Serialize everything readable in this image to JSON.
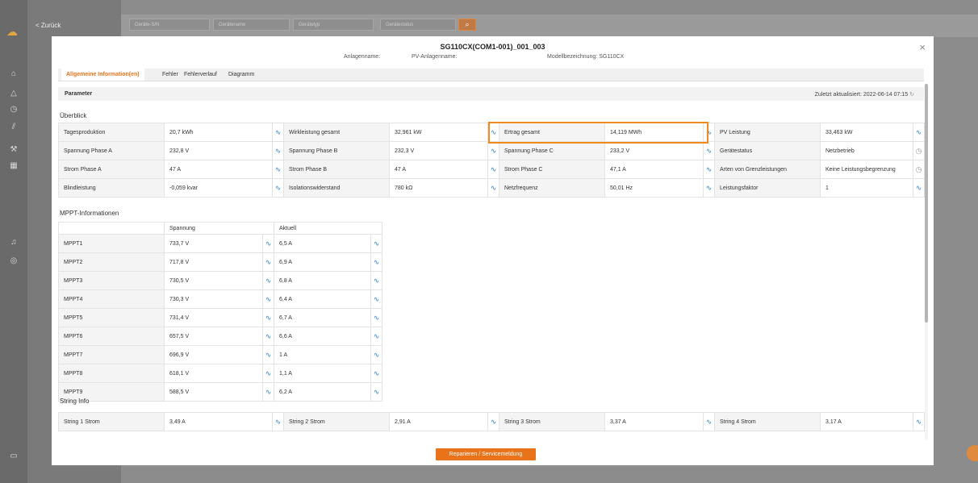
{
  "background": {
    "back_label": "< Zurück",
    "filters": [
      {
        "placeholder": "Geräte-S/N"
      },
      {
        "placeholder": "Gerätename"
      },
      {
        "placeholder": "Gerätetyp"
      },
      {
        "placeholder": "Gerätestatus"
      }
    ]
  },
  "modal": {
    "title": "SG110CX(COM1-001)_001_003",
    "plant_name_label": "Anlagenname:",
    "pv_plant_name_label": "PV-Anlagenname:",
    "model_label": "Modellbezeichnung: SG110CX",
    "tabs": [
      {
        "label": "Allgemeine Information(en)",
        "active": true
      },
      {
        "label": "Fehler"
      },
      {
        "label": "Fehlerverlauf"
      },
      {
        "label": "Diagramm"
      }
    ],
    "param_label": "Parameter",
    "last_updated": "Zuletzt aktualisiert: 2022-06-14 07:15",
    "repair_button": "Reparieren / Servicemeldung"
  },
  "overview": {
    "title": "Überblick",
    "rows": [
      [
        {
          "label": "Tagesproduktion",
          "value": "20,7 kWh",
          "icon": "trend-icon"
        },
        {
          "label": "Wirkleistung gesamt",
          "value": "32,961 kW",
          "icon": "trend-icon"
        },
        {
          "label": "Ertrag gesamt",
          "value": "14,119 MWh",
          "icon": "trend-icon"
        },
        {
          "label": "PV Leistung",
          "value": "33,463 kW",
          "icon": "trend-icon"
        }
      ],
      [
        {
          "label": "Spannung Phase A",
          "value": "232,8 V",
          "icon": "trend-icon"
        },
        {
          "label": "Spannung Phase B",
          "value": "232,3 V",
          "icon": "trend-icon"
        },
        {
          "label": "Spannung Phase C",
          "value": "233,2 V",
          "icon": "trend-icon"
        },
        {
          "label": "Gerätestatus",
          "value": "Netzbetrieb",
          "icon": "clock-icon"
        }
      ],
      [
        {
          "label": "Strom Phase A",
          "value": "47 A",
          "icon": "trend-icon"
        },
        {
          "label": "Strom Phase B",
          "value": "47 A",
          "icon": "trend-icon"
        },
        {
          "label": "Strom Phase C",
          "value": "47,1 A",
          "icon": "trend-icon"
        },
        {
          "label": "Arten von Grenzleistungen",
          "value": "Keine Leistungsbegrenzung",
          "icon": "clock-icon"
        }
      ],
      [
        {
          "label": "Blindleistung",
          "value": "-0,059 kvar",
          "icon": "trend-icon"
        },
        {
          "label": "Isolationswiderstand",
          "value": "780 kΩ",
          "icon": "trend-icon"
        },
        {
          "label": "Netzfrequenz",
          "value": "50,01 Hz",
          "icon": "trend-icon"
        },
        {
          "label": "Leistungsfaktor",
          "value": "1",
          "icon": "trend-icon"
        }
      ]
    ]
  },
  "mppt": {
    "title": "MPPT-Informationen",
    "col_voltage": "Spannung",
    "col_current": "Aktuell",
    "rows": [
      {
        "name": "MPPT1",
        "voltage": "733,7 V",
        "current": "6,5 A"
      },
      {
        "name": "MPPT2",
        "voltage": "717,8 V",
        "current": "6,9 A"
      },
      {
        "name": "MPPT3",
        "voltage": "730,5 V",
        "current": "6,8 A"
      },
      {
        "name": "MPPT4",
        "voltage": "730,3 V",
        "current": "6,4 A"
      },
      {
        "name": "MPPT5",
        "voltage": "731,4 V",
        "current": "6,7 A"
      },
      {
        "name": "MPPT6",
        "voltage": "657,5 V",
        "current": "6,6 A"
      },
      {
        "name": "MPPT7",
        "voltage": "696,9 V",
        "current": "1 A"
      },
      {
        "name": "MPPT8",
        "voltage": "618,1 V",
        "current": "1,1 A"
      },
      {
        "name": "MPPT9",
        "voltage": "588,5 V",
        "current": "6,2 A"
      }
    ]
  },
  "strings": {
    "title": "String Info",
    "rows": [
      [
        {
          "label": "String 1 Strom",
          "value": "3,49 A"
        },
        {
          "label": "String 2 Strom",
          "value": "2,91 A"
        },
        {
          "label": "String 3 Strom",
          "value": "3,37 A"
        },
        {
          "label": "String 4 Strom",
          "value": "3,17 A"
        }
      ]
    ]
  },
  "colors": {
    "accent": "#e8731a",
    "trend_icon": "#2a7fe0",
    "highlight": "#f08a1c"
  }
}
